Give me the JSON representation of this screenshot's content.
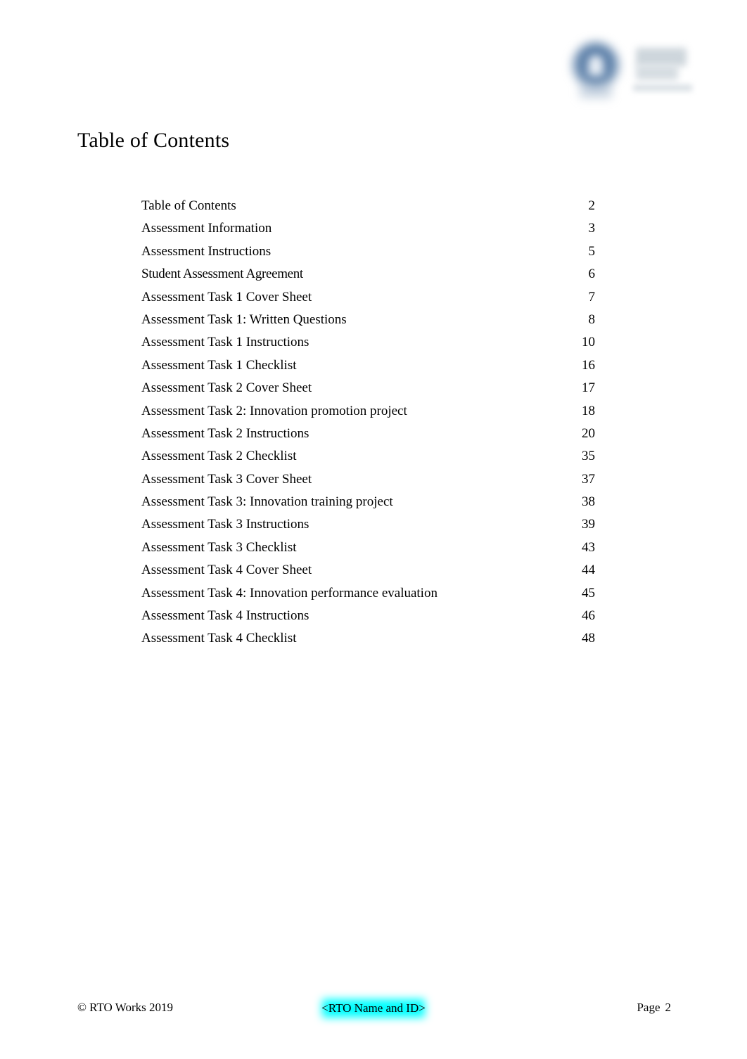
{
  "document": {
    "title": "Table of Contents"
  },
  "header": {
    "logo": {
      "icon": "organisation-logo-redacted",
      "mark_color": "#5b7fa8",
      "text_block_color": "#ced6dc"
    }
  },
  "toc": {
    "entries": [
      {
        "label": "Table of Contents",
        "page": "2"
      },
      {
        "label": "Assessment Information",
        "page": "3"
      },
      {
        "label": "Assessment Instructions",
        "page": "5"
      },
      {
        "label": "Student Assessment Agreement",
        "page": "6"
      },
      {
        "label": "Assessment Task 1 Cover Sheet",
        "page": "7"
      },
      {
        "label": "Assessment Task 1: Written Questions",
        "page": "8"
      },
      {
        "label": "Assessment Task 1 Instructions",
        "page": "10"
      },
      {
        "label": "Assessment Task 1 Checklist",
        "page": "16"
      },
      {
        "label": "Assessment Task 2 Cover Sheet",
        "page": "17"
      },
      {
        "label": "Assessment Task 2: Innovation promotion project",
        "page": "18"
      },
      {
        "label": "Assessment Task 2 Instructions",
        "page": "20"
      },
      {
        "label": "Assessment Task 2 Checklist",
        "page": "35"
      },
      {
        "label": "Assessment Task 3 Cover Sheet",
        "page": "37"
      },
      {
        "label": "Assessment Task 3: Innovation training project",
        "page": "38"
      },
      {
        "label": "Assessment Task 3 Instructions",
        "page": "39"
      },
      {
        "label": "Assessment Task 3 Checklist",
        "page": "43"
      },
      {
        "label": "Assessment Task 4 Cover Sheet",
        "page": "44"
      },
      {
        "label": "Assessment Task 4: Innovation performance evaluation",
        "page": "45"
      },
      {
        "label": "Assessment Task 4 Instructions",
        "page": "46"
      },
      {
        "label": "Assessment Task 4 Checklist",
        "page": "48"
      }
    ]
  },
  "footer": {
    "copyright": "© RTO Works 2019",
    "rto_placeholder": "<RTO Name and ID>",
    "rto_placeholder_highlight": "#00ffff",
    "page_word": "Page",
    "page_number": "2"
  }
}
